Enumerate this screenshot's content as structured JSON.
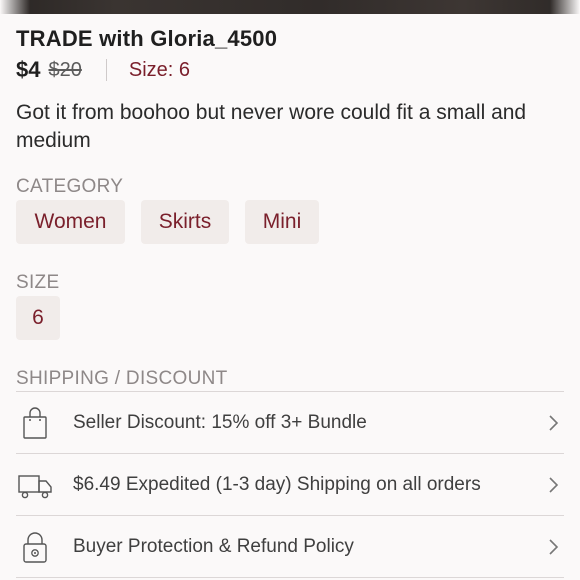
{
  "listing": {
    "title": "TRADE with Gloria_4500",
    "price": "$4",
    "original_price": "$20",
    "size_inline": "Size: 6",
    "description": "Got it from boohoo but never wore could fit a small and medium"
  },
  "category": {
    "label": "CATEGORY",
    "chips": [
      "Women",
      "Skirts",
      "Mini"
    ]
  },
  "size": {
    "label": "SIZE",
    "value": "6"
  },
  "shipping": {
    "label": "SHIPPING / DISCOUNT",
    "rows": [
      {
        "text": "Seller Discount: 15% off 3+ Bundle",
        "icon": "shopping-bag-icon"
      },
      {
        "text": "$6.49 Expedited (1-3 day) Shipping on all orders",
        "icon": "delivery-truck-icon"
      },
      {
        "text": "Buyer Protection & Refund Policy",
        "icon": "padlock-icon"
      }
    ]
  },
  "colors": {
    "accent": "#7a1f2b",
    "chip_bg": "#f1ecea",
    "label_gray": "#8e8888"
  }
}
